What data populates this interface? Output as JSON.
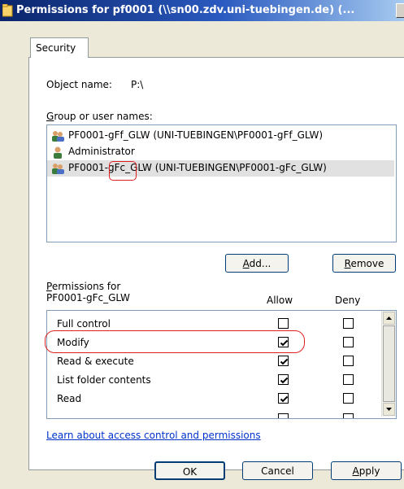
{
  "window": {
    "title": "Permissions for pf0001 (\\\\sn00.zdv.uni-tuebingen.de) (...",
    "icon": "folder-icon"
  },
  "tabs": [
    {
      "label": "Security"
    }
  ],
  "object_name": {
    "label": "Object name:",
    "value": "P:\\"
  },
  "group_label": "Group or user names:",
  "users": [
    {
      "name": "PF0001-gFf_GLW (UNI-TUEBINGEN\\PF0001-gFf_GLW)",
      "icon": "users-group-icon",
      "selected": false
    },
    {
      "name": "Administrator",
      "icon": "user-icon",
      "selected": false
    },
    {
      "name": "PF0001-gFc_GLW (UNI-TUEBINGEN\\PF0001-gFc_GLW)",
      "icon": "users-group-icon",
      "selected": true
    }
  ],
  "buttons": {
    "add": "Add...",
    "remove": "Remove",
    "ok": "OK",
    "cancel": "Cancel",
    "apply": "Apply"
  },
  "permissions": {
    "header_line1": "Permissions for",
    "header_line2": "PF0001-gFc_GLW",
    "allow_label": "Allow",
    "deny_label": "Deny",
    "rows": [
      {
        "name": "Full control",
        "allow": false,
        "deny": false
      },
      {
        "name": "Modify",
        "allow": true,
        "deny": false
      },
      {
        "name": "Read & execute",
        "allow": true,
        "deny": false
      },
      {
        "name": "List folder contents",
        "allow": true,
        "deny": false
      },
      {
        "name": "Read",
        "allow": true,
        "deny": false
      }
    ]
  },
  "learn_link": "Learn about access control and permissions",
  "colors": {
    "annotation": "#e02020",
    "link": "#0033cc",
    "title_bar": "#0a246a"
  }
}
